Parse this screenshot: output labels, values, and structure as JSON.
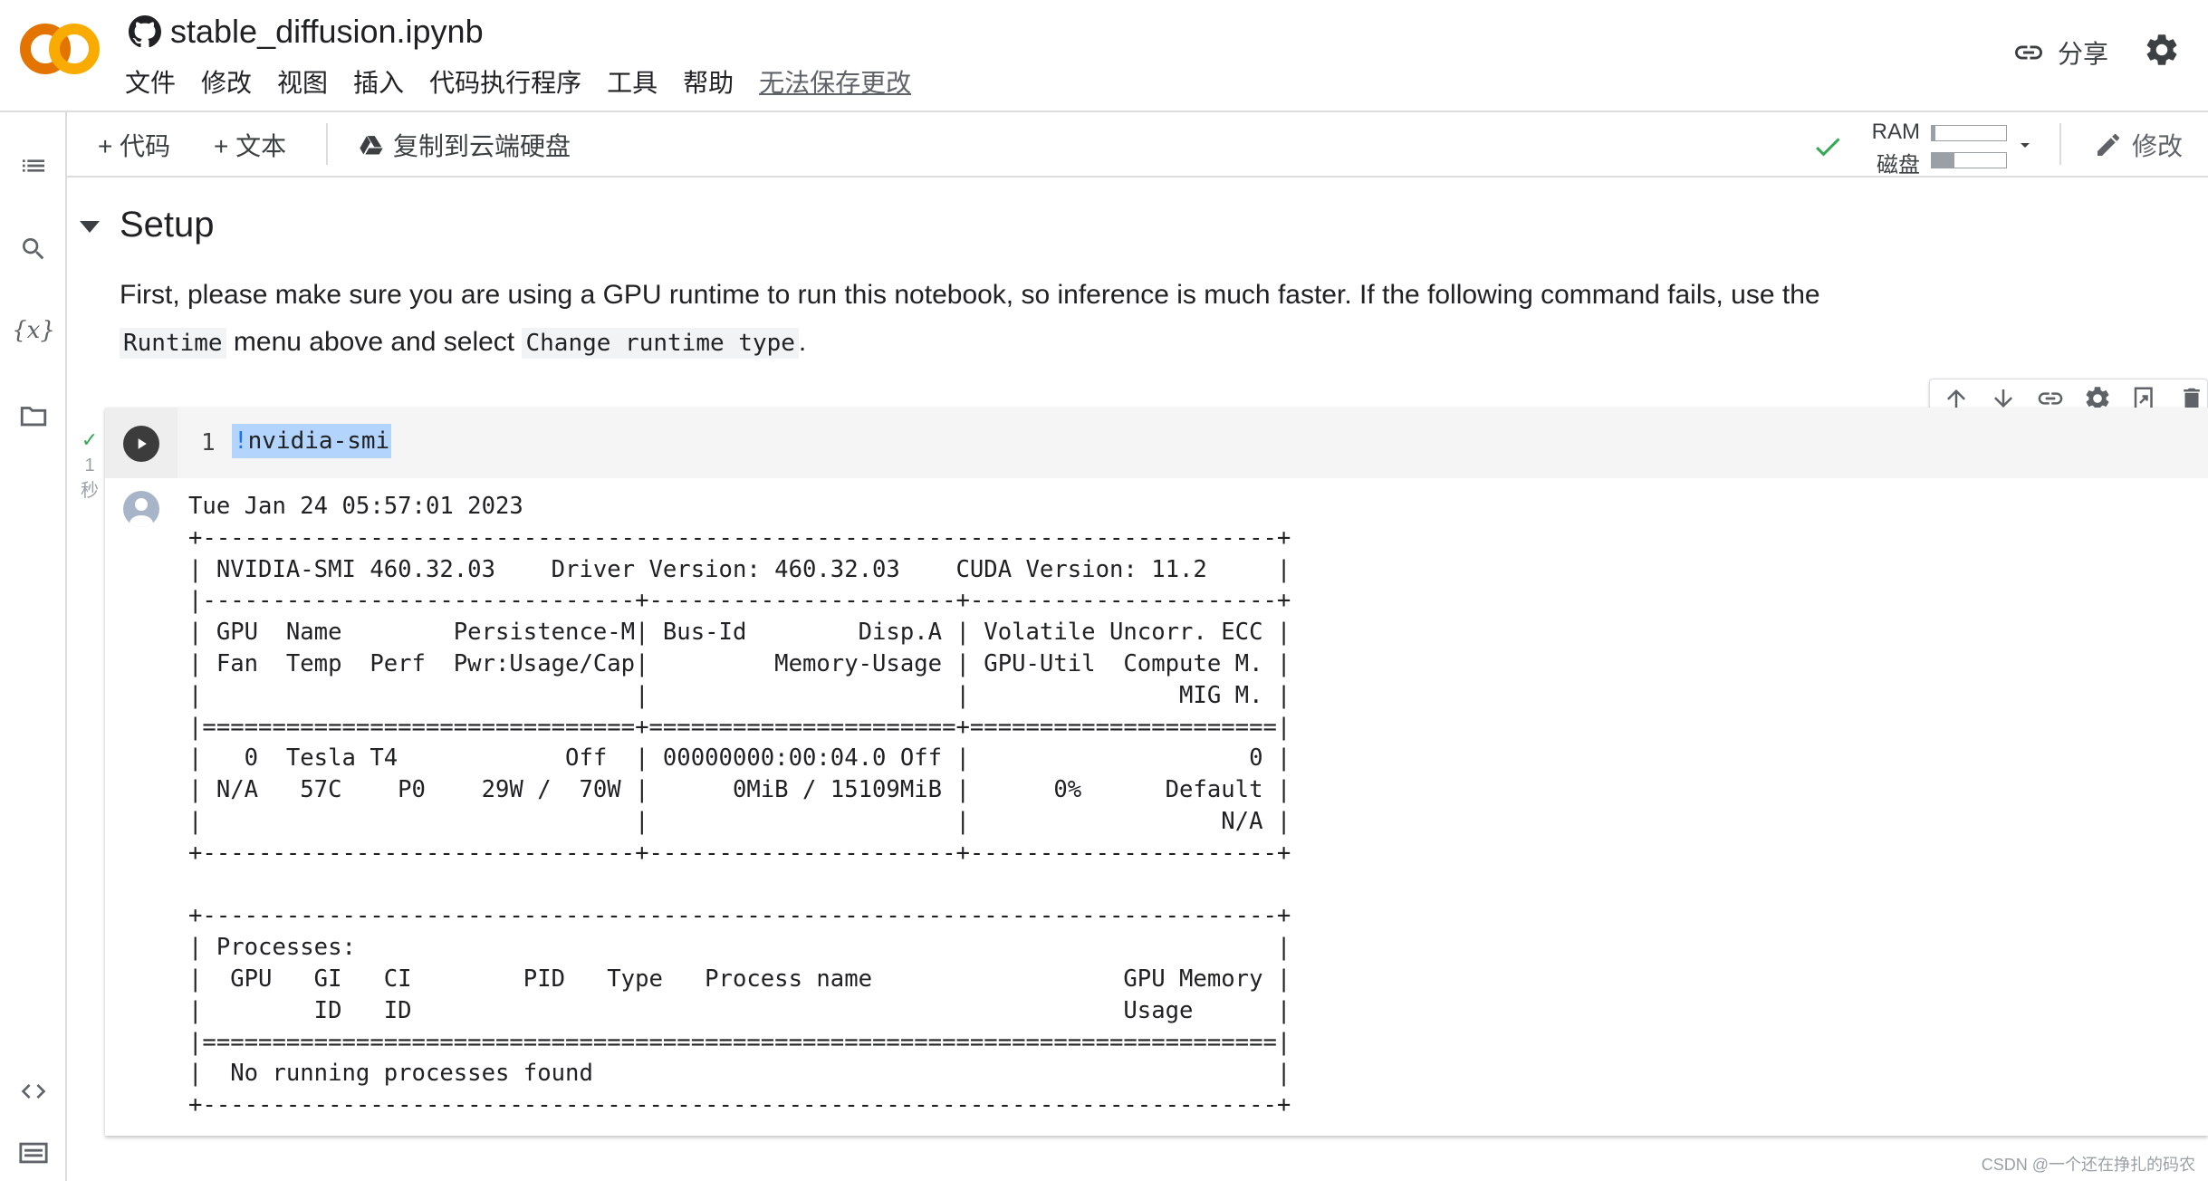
{
  "header": {
    "title": "stable_diffusion.ipynb",
    "menu": [
      "文件",
      "修改",
      "视图",
      "插入",
      "代码执行程序",
      "工具",
      "帮助"
    ],
    "unsaved_notice": "无法保存更改",
    "share_label": "分享",
    "logo_text": "CO"
  },
  "sidebar": {
    "icons": [
      "toc-icon",
      "search-icon",
      "variables-icon",
      "folder-icon",
      "code-snippets-icon",
      "terminal-icon"
    ],
    "variables_glyph": "{x}"
  },
  "toolbar": {
    "add_code": "+ 代码",
    "add_text": "+ 文本",
    "copy_to_drive": "复制到云端硬盘",
    "ram_label": "RAM",
    "disk_label": "磁盘",
    "ram_usage_fraction": 0.05,
    "disk_usage_fraction": 0.3,
    "edit_label": "修改"
  },
  "section": {
    "title": "Setup",
    "para_part1": "First, please make sure you are using a GPU runtime to run this notebook, so inference is much faster. If the following command fails, use the",
    "code1": "Runtime",
    "para_part2": "menu above and select",
    "code2": "Change runtime type",
    "para_part3": "."
  },
  "cell": {
    "exec_check": "✓",
    "exec_count": "1",
    "exec_unit": "秒",
    "line_number": "1",
    "code_bang": "!",
    "code_rest": "nvidia-smi",
    "output": "Tue Jan 24 05:57:01 2023       \n+-----------------------------------------------------------------------------+\n| NVIDIA-SMI 460.32.03    Driver Version: 460.32.03    CUDA Version: 11.2     |\n|-------------------------------+----------------------+----------------------+\n| GPU  Name        Persistence-M| Bus-Id        Disp.A | Volatile Uncorr. ECC |\n| Fan  Temp  Perf  Pwr:Usage/Cap|         Memory-Usage | GPU-Util  Compute M. |\n|                               |                      |               MIG M. |\n|===============================+======================+======================|\n|   0  Tesla T4            Off  | 00000000:00:04.0 Off |                    0 |\n| N/A   57C    P0    29W /  70W |      0MiB / 15109MiB |      0%      Default |\n|                               |                      |                  N/A |\n+-------------------------------+----------------------+----------------------+\n                                                                               \n+-----------------------------------------------------------------------------+\n| Processes:                                                                  |\n|  GPU   GI   CI        PID   Type   Process name                  GPU Memory |\n|        ID   ID                                                   Usage      |\n|=============================================================================|\n|  No running processes found                                                 |\n+-----------------------------------------------------------------------------+"
  },
  "watermark": "CSDN @一个还在挣扎的码农",
  "colors": {
    "logo_orange": "#F9AB00",
    "logo_dark_orange": "#E37400",
    "check_green": "#34a853"
  }
}
